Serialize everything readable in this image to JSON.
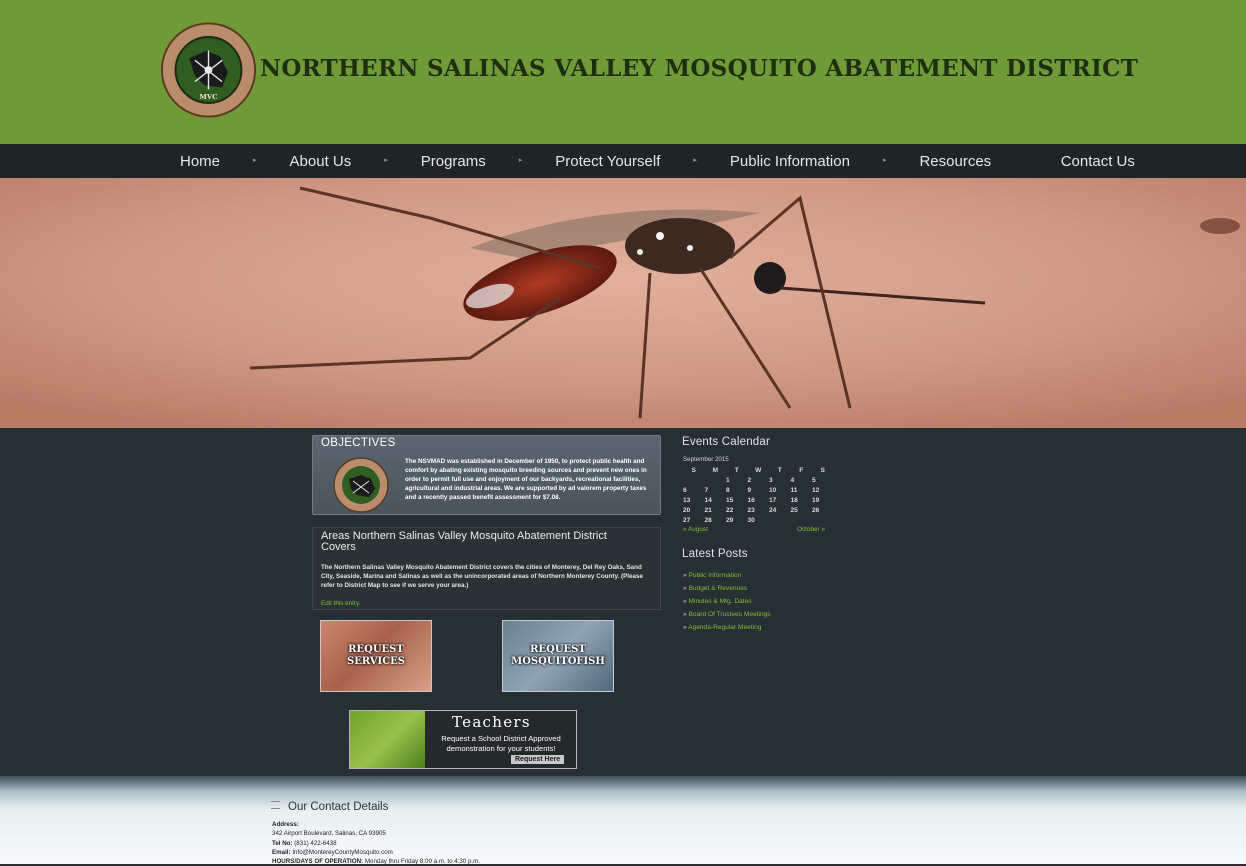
{
  "site": {
    "title": "NORTHERN SALINAS VALLEY MOSQUITO ABATEMENT DISTRICT",
    "logo_text": "NORTHERN SALINAS VALLEY MOSQUITO ABATEMENT DISTRICT",
    "logo_initials": "MVC"
  },
  "nav": {
    "items": [
      {
        "label": "Home"
      },
      {
        "label": "About Us"
      },
      {
        "label": "Programs"
      },
      {
        "label": "Protect Yourself"
      },
      {
        "label": "Public Information"
      },
      {
        "label": "Resources"
      },
      {
        "label": "Contact Us"
      }
    ]
  },
  "objectives": {
    "title": "OBJECTIVES",
    "text": "The NSVMAD was established in December of 1950, to protect public health and comfort by abating existing mosquito breeding sources and prevent new ones in order to permit full use and enjoyment of our backyards, recreational facilities, agricultural and industrial areas. We are supported by ad valorem property taxes and a recently passed benefit assessment for $7.08."
  },
  "coverage": {
    "title": "Areas Northern Salinas Valley Mosquito Abatement District Covers",
    "text": "The Northern Salinas Valley Mosquito Abatement District covers the cities of Monterey, Del Rey Oaks, Sand City, Seaside, Marina and Salinas as well as the unincorporated areas of Northern Monterey County. (Please refer to District Map to see if we serve your area.)",
    "edit_link": "Edit this entry."
  },
  "buttons": {
    "services_label": "REQUEST SERVICES",
    "fish_label": "REQUEST MOSQUITOFISH"
  },
  "teachers": {
    "title": "Teachers",
    "text": "Request a School District Approved demonstration for your students!",
    "button": "Request Here"
  },
  "calendar": {
    "heading": "Events Calendar",
    "caption": "September 2015",
    "days": [
      "S",
      "M",
      "T",
      "W",
      "T",
      "F",
      "S"
    ],
    "weeks": [
      [
        "",
        "",
        "1",
        "2",
        "3",
        "4",
        "5"
      ],
      [
        "6",
        "7",
        "8",
        "9",
        "10",
        "11",
        "12"
      ],
      [
        "13",
        "14",
        "15",
        "16",
        "17",
        "18",
        "19"
      ],
      [
        "20",
        "21",
        "22",
        "23",
        "24",
        "25",
        "26"
      ],
      [
        "27",
        "28",
        "29",
        "30",
        "",
        "",
        ""
      ]
    ],
    "prev": "« August",
    "next": "October »"
  },
  "latest_posts": {
    "heading": "Latest Posts",
    "arrow": "»",
    "items": [
      "Public Information",
      "Budget & Revenues",
      "Minutes & Mtg. Dates",
      "Board Of Trustees Meetings",
      "Agenda-Regular Meeting"
    ]
  },
  "contact": {
    "heading": "Our Contact Details",
    "address_label": "Address:",
    "address": "342 Airport Boulevard, Salinas, CA 93905",
    "tel_label": "Tel No:",
    "tel": "(831) 422-6438",
    "email_label": "Email:",
    "email": "Info@MontereyCountyMosquito.com",
    "hours_label": "HOURS/DAYS OF OPERATION:",
    "hours": "Monday thru Friday 8:00 a.m. to 4:30 p.m."
  },
  "colors": {
    "header_green": "#6f9a37",
    "nav_dark": "#1f2427",
    "body_dark": "#262f33",
    "link_green": "#7fbf33"
  }
}
